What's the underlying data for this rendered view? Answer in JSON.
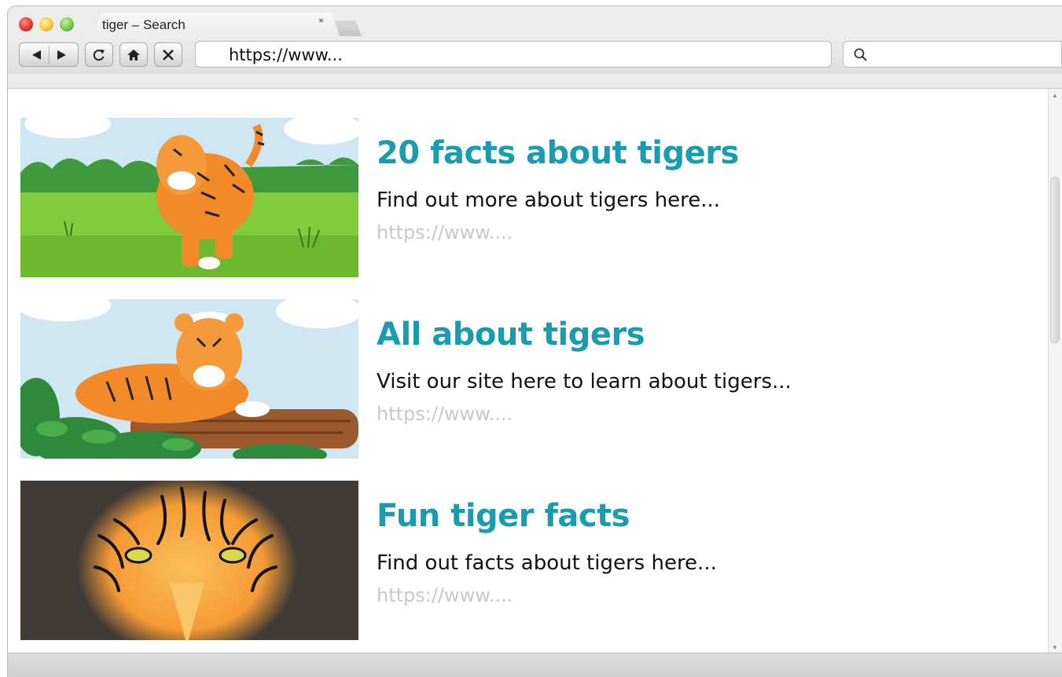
{
  "browser": {
    "tab_title": "tiger – Search",
    "tab_close": "×",
    "url": "https://www...",
    "search_placeholder": ""
  },
  "results": [
    {
      "title": "20 facts about tigers",
      "description": "Find out more about tigers here...",
      "url": "https://www....",
      "image": "tiger-standing-in-grass-illustration"
    },
    {
      "title": "All about tigers",
      "description": "Visit our site here to learn about tigers...",
      "url": "https://www....",
      "image": "tiger-lying-on-log-illustration"
    },
    {
      "title": "Fun tiger facts",
      "description": "Find out facts about tigers here...",
      "url": "https://www....",
      "image": "tiger-face-closeup-illustration"
    }
  ],
  "colors": {
    "result_title": "#1a9cb0",
    "result_url": "#c8c8c8",
    "close_button": "#e0322a",
    "minimize_button": "#f5c42c",
    "zoom_button": "#6cc33b"
  }
}
